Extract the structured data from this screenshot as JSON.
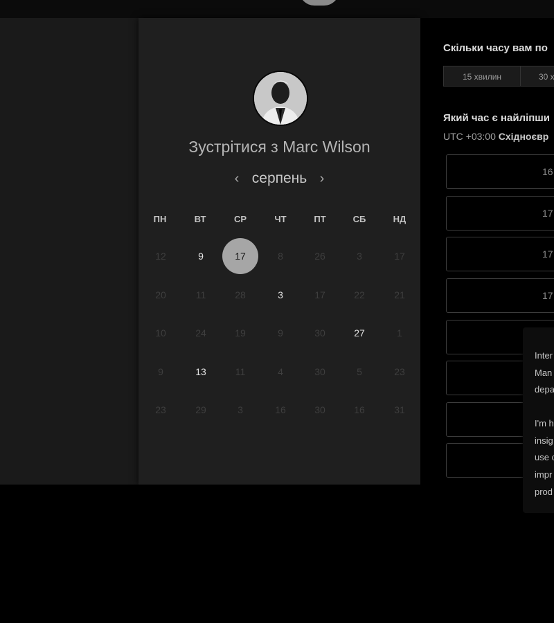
{
  "booking": {
    "title": "Зустрітися з Marc Wilson",
    "avatar_icon": "person-avatar"
  },
  "calendar": {
    "month": "серпень",
    "prev_icon": "chevron-left-icon",
    "next_icon": "chevron-right-icon",
    "weekdays": [
      "ПН",
      "ВТ",
      "СР",
      "ЧТ",
      "ПТ",
      "СБ",
      "НД"
    ],
    "weeks": [
      [
        "12",
        "9",
        "17",
        "8",
        "26",
        "3",
        "17"
      ],
      [
        "20",
        "11",
        "28",
        "3",
        "17",
        "22",
        "21"
      ],
      [
        "10",
        "24",
        "19",
        "9",
        "30",
        "27",
        "1"
      ],
      [
        "9",
        "13",
        "11",
        "4",
        "30",
        "5",
        "23"
      ],
      [
        "23",
        "29",
        "3",
        "16",
        "30",
        "16",
        "31"
      ]
    ],
    "available": [
      [
        0,
        1
      ],
      [
        0,
        2
      ],
      [
        1,
        3
      ],
      [
        2,
        5
      ],
      [
        3,
        1
      ]
    ],
    "selected": [
      0,
      2
    ]
  },
  "duration": {
    "question": "Скільки часу вам по",
    "options": [
      "15 хвилин",
      "30 х"
    ]
  },
  "times": {
    "question": "Який час є найліпши",
    "timezone_prefix": "UTC +03:00",
    "timezone_name": "Східноєвр",
    "slots": [
      "16",
      "17",
      "17",
      "17",
      "",
      "",
      "",
      ""
    ]
  },
  "tooltip": {
    "lines": [
      "Inter",
      "Man",
      "depa",
      "",
      "I'm h",
      "insig",
      "use c",
      "impr",
      "prod"
    ]
  },
  "colors": {
    "selected_day": "#a6a6a6",
    "panel_bg": "#1f1f1f",
    "page_bg": "#000000"
  }
}
